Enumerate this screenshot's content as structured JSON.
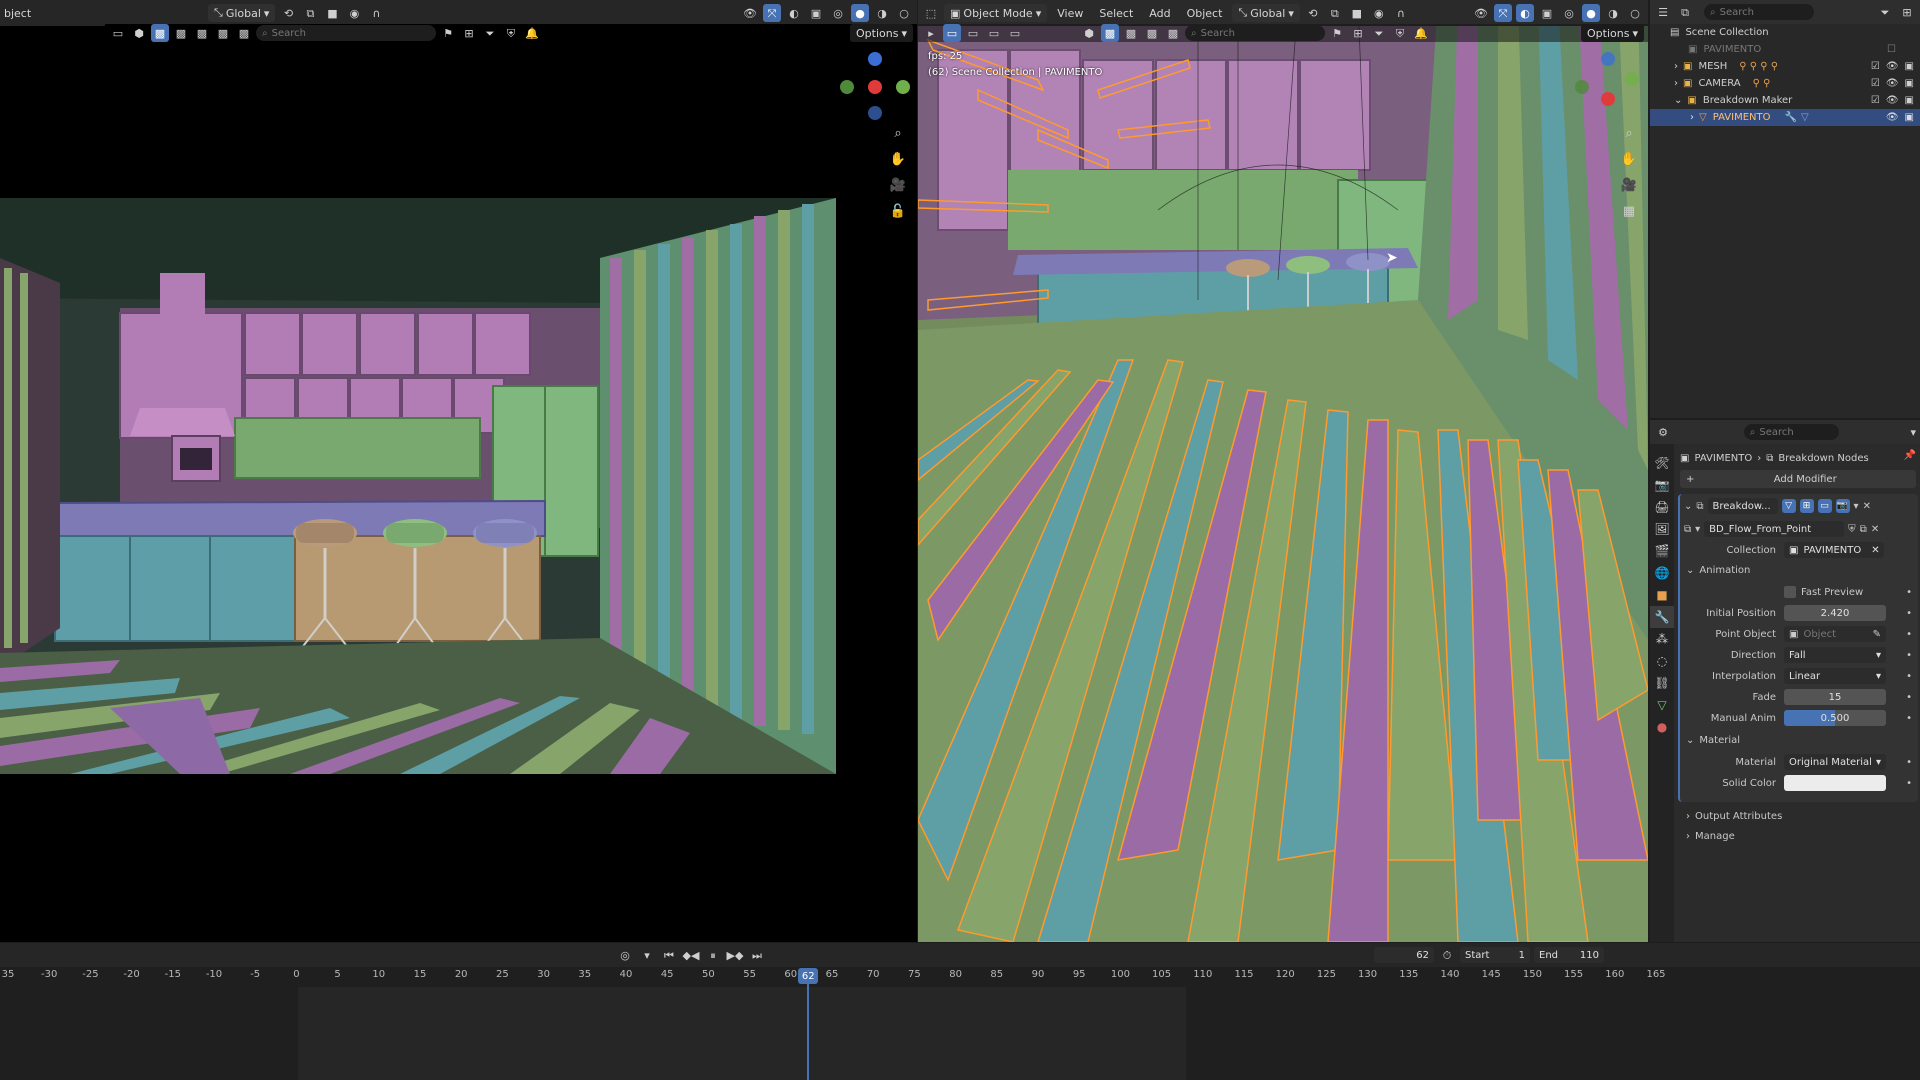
{
  "top_left": {
    "mode_partial": "bject",
    "orientation": "Global",
    "options": "Options",
    "search_placeholder": "Search"
  },
  "top_right": {
    "mode": "Object Mode",
    "menus": [
      "View",
      "Select",
      "Add",
      "Object"
    ],
    "orientation": "Global",
    "options": "Options",
    "search_placeholder": "Search",
    "overlay_fps": "fps: 25",
    "overlay_info": "(62) Scene Collection | PAVIMENTO"
  },
  "colors": {
    "accent": "#4772b3",
    "selected_orange": "#ff9a2e",
    "floor_purple": "#9b6ba5",
    "floor_teal": "#5e9fa6",
    "floor_green": "#87a46b",
    "wall_pink": "#b07ab0"
  },
  "outliner": {
    "search_placeholder": "Search",
    "root": "Scene Collection",
    "items": [
      {
        "label": "PAVIMENTO",
        "dim": true
      },
      {
        "label": "MESH"
      },
      {
        "label": "CAMERA"
      },
      {
        "label": "Breakdown Maker"
      },
      {
        "label": "PAVIMENTO",
        "selected": true
      }
    ]
  },
  "properties": {
    "search_placeholder": "Search",
    "breadcrumb_object": "PAVIMENTO",
    "breadcrumb_modifier": "Breakdown Nodes",
    "add_modifier": "Add Modifier",
    "modifier_name": "Breakdow...",
    "node_group": "BD_Flow_From_Point",
    "collection_label": "Collection",
    "collection_value": "PAVIMENTO",
    "panel_animation": "Animation",
    "fast_preview": "Fast Preview",
    "initial_position_label": "Initial Position",
    "initial_position_value": "2.420",
    "point_object_label": "Point Object",
    "point_object_placeholder": "Object",
    "direction_label": "Direction",
    "direction_value": "Fall",
    "interpolation_label": "Interpolation",
    "interpolation_value": "Linear",
    "fade_label": "Fade",
    "fade_value": "15",
    "manual_anim_label": "Manual Anim",
    "manual_anim_value": "0.500",
    "manual_anim_fraction": 0.5,
    "panel_material": "Material",
    "material_label": "Material",
    "material_value": "Original Material",
    "solid_color_label": "Solid Color",
    "solid_color_value": "#ececec",
    "panel_output": "Output Attributes",
    "panel_manage": "Manage"
  },
  "timeline": {
    "current_frame": "62",
    "start_label": "Start",
    "start_value": "1",
    "end_label": "End",
    "end_value": "110",
    "ticks": [
      "35",
      "-30",
      "-25",
      "-20",
      "-15",
      "-10",
      "-5",
      "0",
      "5",
      "10",
      "15",
      "20",
      "25",
      "30",
      "35",
      "40",
      "45",
      "50",
      "55",
      "60",
      "65",
      "70",
      "75",
      "80",
      "85",
      "90",
      "95",
      "100",
      "105",
      "110",
      "115",
      "120",
      "125",
      "130",
      "135",
      "140",
      "145",
      "150",
      "155",
      "160",
      "165"
    ],
    "playhead_label": "62"
  }
}
